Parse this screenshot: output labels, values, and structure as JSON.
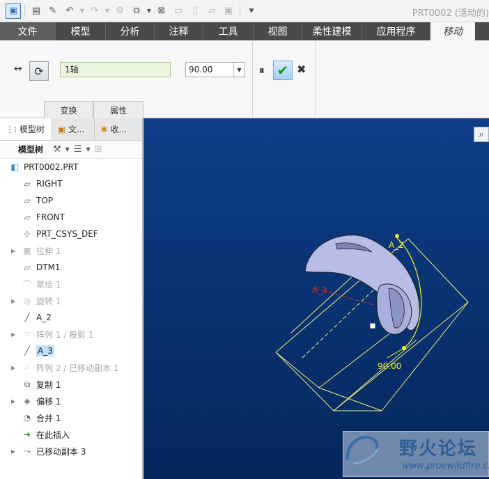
{
  "window": {
    "title": "PRT0002 (活动的)"
  },
  "quick_access": {
    "buttons": [
      "new-icon",
      "save-icon",
      "regenerate-icon",
      "undo-icon",
      "redo-icon",
      "feature-icon",
      "switch-window-icon",
      "close-icon",
      "open-icon",
      "new-file-icon",
      "save-file-icon",
      "more-icon"
    ]
  },
  "ribbon": {
    "tabs": [
      {
        "label": "文件",
        "active": false
      },
      {
        "label": "模型",
        "active": false
      },
      {
        "label": "分析",
        "active": false
      },
      {
        "label": "注释",
        "active": false
      },
      {
        "label": "工具",
        "active": false
      },
      {
        "label": "视图",
        "active": false
      },
      {
        "label": "柔性建模",
        "active": false
      },
      {
        "label": "应用程序",
        "active": false
      },
      {
        "label": "移动",
        "active": true
      }
    ]
  },
  "dashboard": {
    "move_type_icon": "↔",
    "rotate_icon": "⟳",
    "reference_value": "1轴",
    "angle_value": "90.00",
    "subtabs": [
      "变换",
      "属性"
    ],
    "pause_icon": "⏸",
    "confirm_icon": "✔",
    "cancel_icon": "✖",
    "colors": {
      "reference_bg": "#eaf7dc",
      "confirm_green": "#1b9a2c"
    }
  },
  "left_panel": {
    "tabs": [
      {
        "label": "模型树",
        "icon": "model-tree-icon"
      },
      {
        "label": "文...",
        "icon": "folder-icon"
      },
      {
        "label": "收...",
        "icon": "favorites-icon"
      }
    ],
    "tree_toolbar_label": "模型树",
    "tree": [
      {
        "label": "PRT0002.PRT",
        "icon": "part-icon",
        "root": true,
        "expand": false,
        "grey": false,
        "selected": false
      },
      {
        "label": "RIGHT",
        "icon": "datum-plane-icon",
        "expand": false,
        "grey": false,
        "selected": false
      },
      {
        "label": "TOP",
        "icon": "datum-plane-icon",
        "expand": false,
        "grey": false,
        "selected": false
      },
      {
        "label": "FRONT",
        "icon": "datum-plane-icon",
        "expand": false,
        "grey": false,
        "selected": false
      },
      {
        "label": "PRT_CSYS_DEF",
        "icon": "csys-icon",
        "expand": false,
        "grey": false,
        "selected": false
      },
      {
        "label": "拉伸 1",
        "icon": "extrude-icon",
        "expand": true,
        "grey": true,
        "selected": false
      },
      {
        "label": "DTM1",
        "icon": "datum-plane-icon",
        "expand": false,
        "grey": false,
        "selected": false
      },
      {
        "label": "草绘 1",
        "icon": "sketch-icon",
        "expand": false,
        "grey": true,
        "selected": false
      },
      {
        "label": "旋转 1",
        "icon": "revolve-icon",
        "expand": true,
        "grey": true,
        "selected": false
      },
      {
        "label": "A_2",
        "icon": "datum-axis-icon",
        "expand": false,
        "grey": false,
        "selected": false
      },
      {
        "label": "阵列 1 / 投影 1",
        "icon": "pattern-icon",
        "expand": true,
        "grey": true,
        "selected": false
      },
      {
        "label": "A_3",
        "icon": "datum-axis-icon",
        "expand": false,
        "grey": false,
        "selected": true
      },
      {
        "label": "阵列 2 / 已移动副本 1",
        "icon": "pattern-icon",
        "expand": true,
        "grey": true,
        "selected": false
      },
      {
        "label": "复制 1",
        "icon": "copy-icon",
        "expand": false,
        "grey": false,
        "selected": false
      },
      {
        "label": "偏移 1",
        "icon": "offset-icon",
        "expand": true,
        "grey": false,
        "selected": false
      },
      {
        "label": "合并 1",
        "icon": "merge-icon",
        "expand": false,
        "grey": false,
        "selected": false
      },
      {
        "label": "在此插入",
        "icon": "insert-here-icon",
        "expand": false,
        "grey": false,
        "selected": false
      },
      {
        "label": "已移动副本 3",
        "icon": "moved-copy-icon",
        "expand": true,
        "grey": false,
        "selected": false
      }
    ]
  },
  "graphics": {
    "axis_labels": [
      "A_2",
      "A_3"
    ],
    "angle_annotation": "90.00",
    "colors": {
      "background": "#0a3577",
      "bounding_box": "#e8f07a",
      "surface": "#b8bde8",
      "axis_red": "#d22626",
      "dimension": "#f2f227"
    }
  },
  "watermark": {
    "title": "野火论坛",
    "url": "www.proewildfire.cn"
  }
}
